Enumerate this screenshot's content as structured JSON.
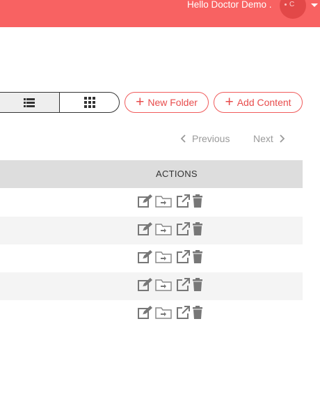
{
  "header": {
    "greeting": "Hello Doctor Demo .",
    "avatar_initial": "C",
    "accent_color": "#f86262"
  },
  "toolbar": {
    "view_list_icon": "list-view-icon",
    "view_grid_icon": "grid-view-icon",
    "new_folder_label": "New Folder",
    "add_content_label": "Add Content"
  },
  "pagination": {
    "previous_label": "Previous",
    "next_label": "Next"
  },
  "table": {
    "columns": [
      "ACTIONS"
    ],
    "rows": [
      {
        "actions": [
          "edit-icon",
          "move-to-folder-icon",
          "open-external-icon",
          "delete-icon"
        ]
      },
      {
        "actions": [
          "edit-icon",
          "move-to-folder-icon",
          "open-external-icon",
          "delete-icon"
        ]
      },
      {
        "actions": [
          "edit-icon",
          "move-to-folder-icon",
          "open-external-icon",
          "delete-icon"
        ]
      },
      {
        "actions": [
          "edit-icon",
          "move-to-folder-icon",
          "open-external-icon",
          "delete-icon"
        ]
      },
      {
        "actions": [
          "edit-icon",
          "move-to-folder-icon",
          "open-external-icon",
          "delete-icon"
        ]
      }
    ]
  }
}
